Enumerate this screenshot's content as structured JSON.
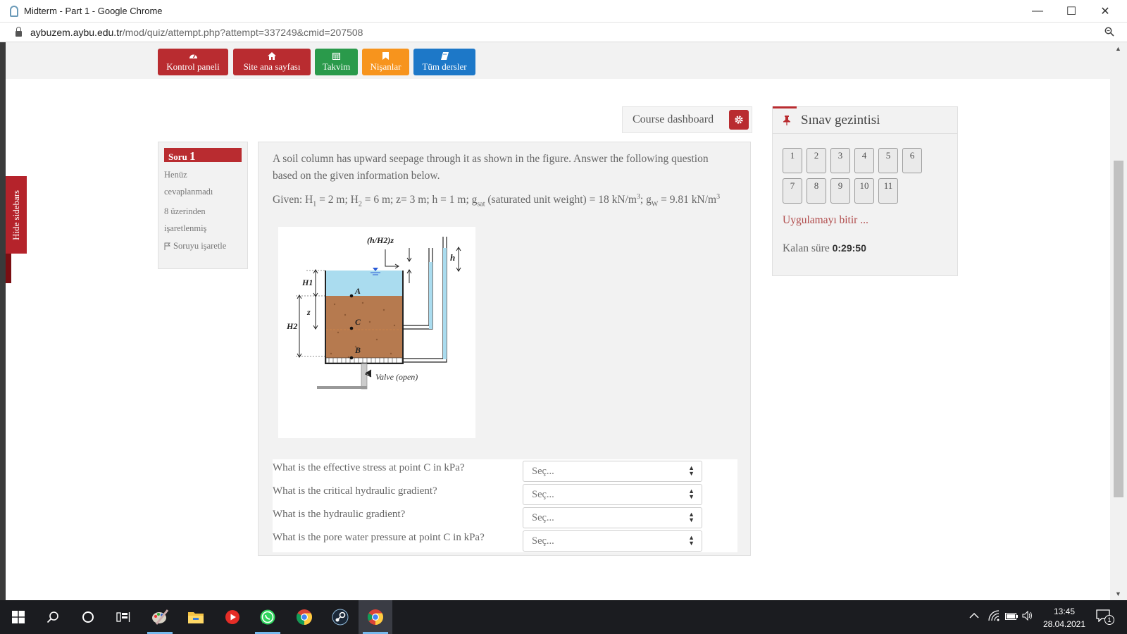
{
  "window": {
    "title": "Midterm - Part 1 - Google Chrome",
    "minimize": "—",
    "maximize": "☐",
    "close": "✕"
  },
  "address": {
    "domain": "aybuzem.aybu.edu.tr",
    "path": "/mod/quiz/attempt.php?attempt=337249&cmid=207508"
  },
  "nav": {
    "buttons": [
      {
        "label": "Kontrol paneli",
        "icon": "dashboard-icon",
        "color": "#b92c30"
      },
      {
        "label": "Site ana sayfası",
        "icon": "home-icon",
        "color": "#b92c30"
      },
      {
        "label": "Takvim",
        "icon": "calendar-icon",
        "color": "#2a9a4b"
      },
      {
        "label": "Nişanlar",
        "icon": "bookmark-icon",
        "color": "#f7941d"
      },
      {
        "label": "Tüm dersler",
        "icon": "book-icon",
        "color": "#1d78c8"
      }
    ]
  },
  "sidebar_toggle": "Hide sidebars",
  "course_dashboard": {
    "label": "Course dashboard",
    "icon": "gear-icon"
  },
  "question_info": {
    "label": "Soru",
    "number": "1",
    "status_line1": "Henüz",
    "status_line2": "cevaplanmadı",
    "points_line1": "8 üzerinden",
    "points_line2": "işaretlenmiş",
    "flag_label": "Soruyu işaretle"
  },
  "question": {
    "text": "A soil column has upward seepage through it as shown in the figure. Answer the following question based on the given information below.",
    "given": {
      "prefix": "Given: H",
      "h1_sub": "1",
      "h1_val": " = 2 m; H",
      "h2_sub": "2",
      "h2_val": " = 6 m; z= 3 m; h = 1 m; g",
      "gsat_sub": "sat",
      "gsat_val": " (saturated unit weight) = 18 kN/m",
      "sup3a": "3",
      "gw_prefix": "; g",
      "gw_sub": "W",
      "gw_val": " = 9.81 kN/m",
      "sup3b": "3"
    },
    "figure_labels": {
      "top_label": "(h/H2)z",
      "h": "h",
      "H1": "H1",
      "H2": "H2",
      "z": "z",
      "A": "A",
      "B": "B",
      "C": "C",
      "valve": "Valve (open)"
    }
  },
  "answers": [
    {
      "question": "What is the effective stress at point C in kPa?",
      "selected": "Seç..."
    },
    {
      "question": "What is the critical hydraulic gradient?",
      "selected": "Seç..."
    },
    {
      "question": "What is the hydraulic gradient?",
      "selected": "Seç..."
    },
    {
      "question": "What is the pore water pressure at point C in kPa?",
      "selected": "Seç..."
    }
  ],
  "quiz_nav": {
    "title": "Sınav gezintisi",
    "buttons": [
      "1",
      "2",
      "3",
      "4",
      "5",
      "6",
      "7",
      "8",
      "9",
      "10",
      "11"
    ],
    "finish": "Uygulamayı bitir ...",
    "time_label": "Kalan süre",
    "time_value": "0:29:50"
  },
  "taskbar": {
    "time": "13:45",
    "date": "28.04.2021",
    "notification_count": "1"
  },
  "colors": {
    "brand_red": "#b92c30",
    "green": "#2a9a4b",
    "orange": "#f7941d",
    "blue": "#1d78c8"
  }
}
